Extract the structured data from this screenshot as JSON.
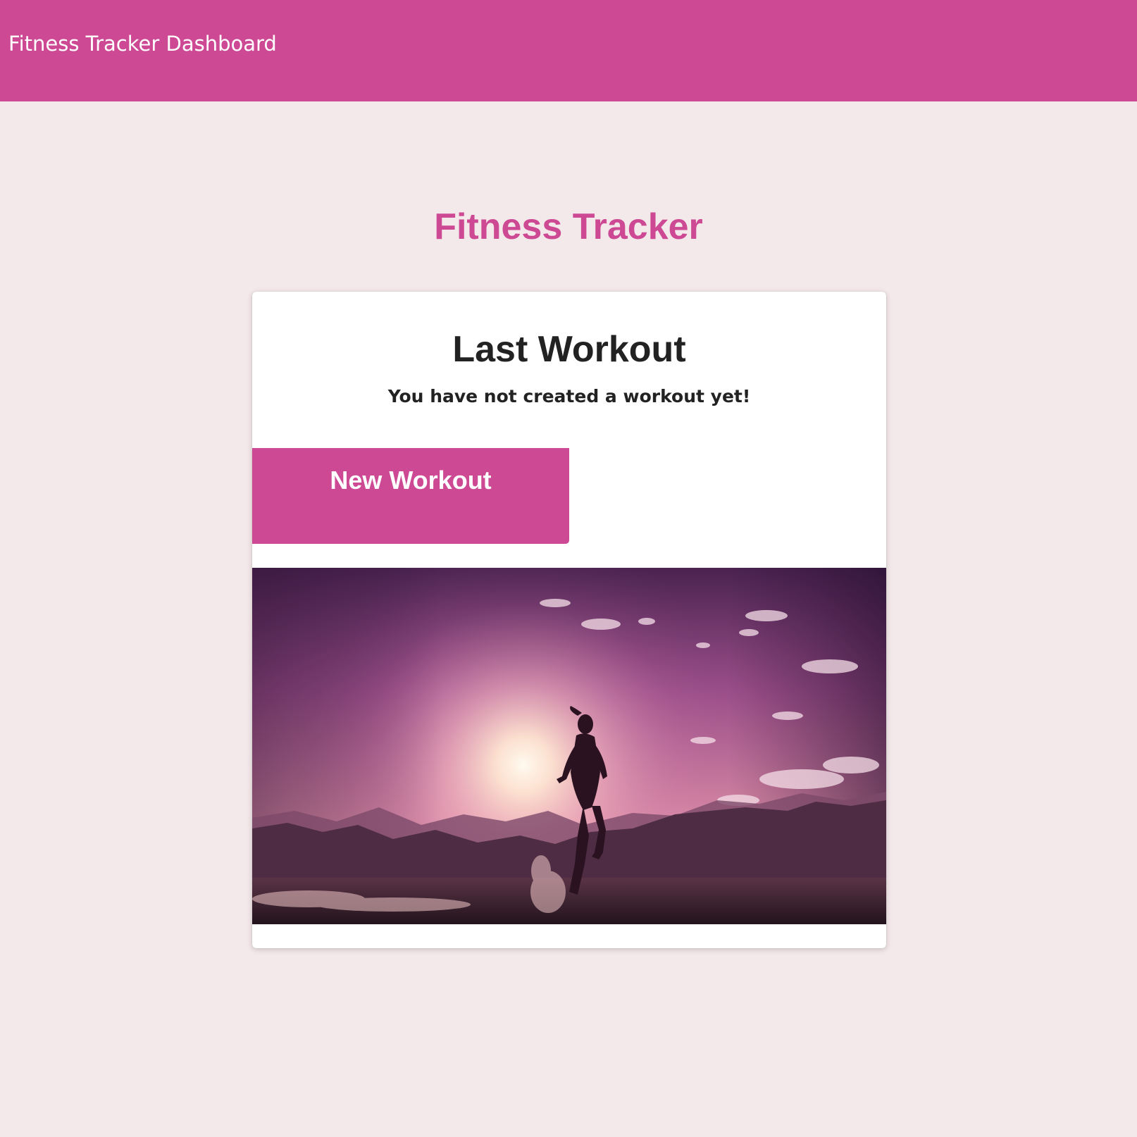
{
  "navbar": {
    "title": "Fitness Tracker Dashboard"
  },
  "page": {
    "title": "Fitness Tracker"
  },
  "card": {
    "title": "Last Workout",
    "message": "You have not created a workout yet!",
    "new_workout_button": "New Workout",
    "image": {
      "subject": "runner-silhouette-at-sunset",
      "colors": {
        "sky_top": "#4a2350",
        "sky_mid": "#b0558f",
        "sun_glow": "#fff4e0",
        "horizon": "#e8a0a0",
        "ground": "#2d1a24"
      }
    }
  },
  "theme": {
    "accent": "#cd4993",
    "background": "#f3e8ea",
    "card_background": "#ffffff",
    "text_dark": "#222222"
  }
}
